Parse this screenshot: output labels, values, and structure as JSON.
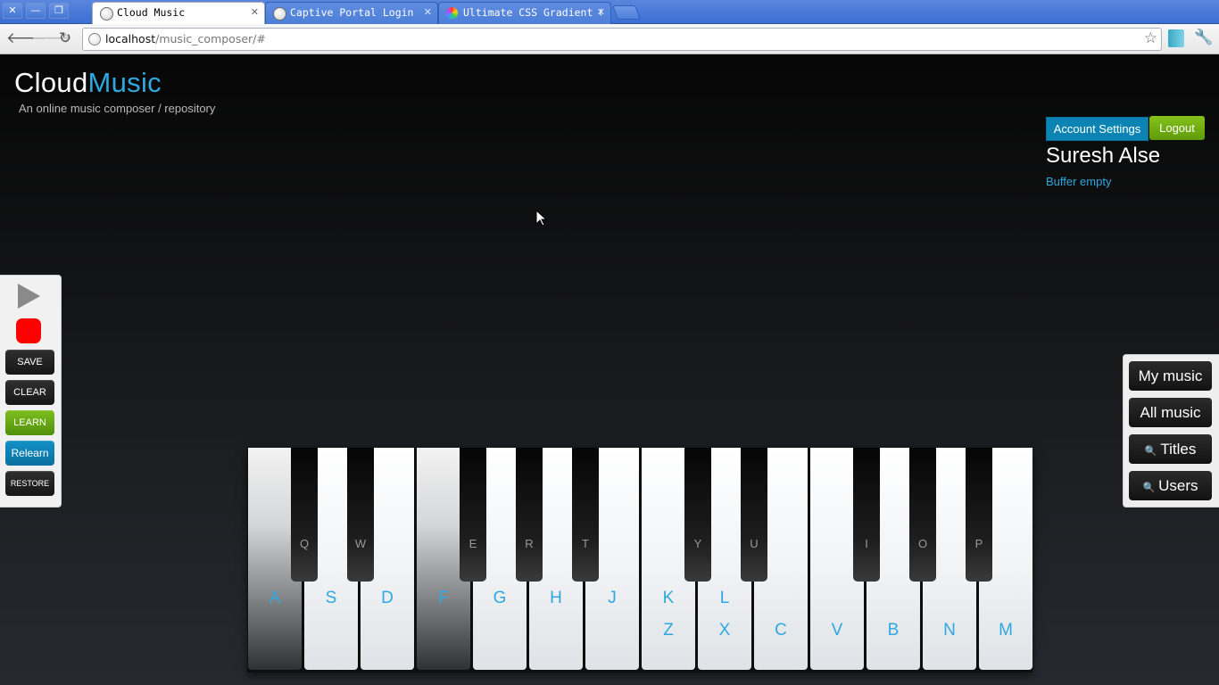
{
  "browser": {
    "tabs": [
      {
        "title": "Cloud Music",
        "active": true
      },
      {
        "title": "Captive Portal Login",
        "active": false
      },
      {
        "title": "Ultimate CSS Gradient Ge",
        "active": false
      }
    ],
    "address": {
      "host": "localhost",
      "path": "/music_composer/#"
    },
    "window_controls": {
      "close": "✕",
      "minimize": "—",
      "restore": "❐"
    },
    "icons": {
      "back": "back-arrow-icon",
      "forward": "forward-arrow-icon",
      "reload": "reload-icon",
      "bookmark": "star-icon",
      "wrench": "wrench-icon"
    }
  },
  "header": {
    "logo_primary": "Cloud",
    "logo_accent": "Music",
    "tagline": "An online music composer / repository",
    "accent_color": "#2ea8e0"
  },
  "account": {
    "settings_label": "Account Settings",
    "logout_label": "Logout",
    "username": "Suresh Alse",
    "buffer_status": "Buffer empty"
  },
  "controls": {
    "save": "SAVE",
    "clear": "CLEAR",
    "learn": "LEARN",
    "relearn": "Relearn",
    "restore": "RESTORE",
    "record_color": "#ff0000"
  },
  "menu": {
    "my_music": "My music",
    "all_music": "All music",
    "titles": "Titles",
    "users": "Users"
  },
  "piano": {
    "white_keys": [
      {
        "label": "A",
        "pressed": true
      },
      {
        "label": "S",
        "pressed": false
      },
      {
        "label": "D",
        "pressed": false
      },
      {
        "label": "F",
        "pressed": true
      },
      {
        "label": "G",
        "pressed": false
      },
      {
        "label": "H",
        "pressed": false
      },
      {
        "label": "J",
        "pressed": false
      },
      {
        "label": "K",
        "alt": "Z",
        "pressed": false
      },
      {
        "label": "L",
        "alt": "X",
        "pressed": false
      },
      {
        "label": "C",
        "pressed": false
      },
      {
        "label": "V",
        "pressed": false
      },
      {
        "label": "B",
        "pressed": false
      },
      {
        "label": "N",
        "pressed": false
      },
      {
        "label": "M",
        "pressed": false
      }
    ],
    "black_keys": [
      "Q",
      "W",
      "E",
      "R",
      "T",
      "Y",
      "U",
      "I",
      "O",
      "P"
    ]
  }
}
